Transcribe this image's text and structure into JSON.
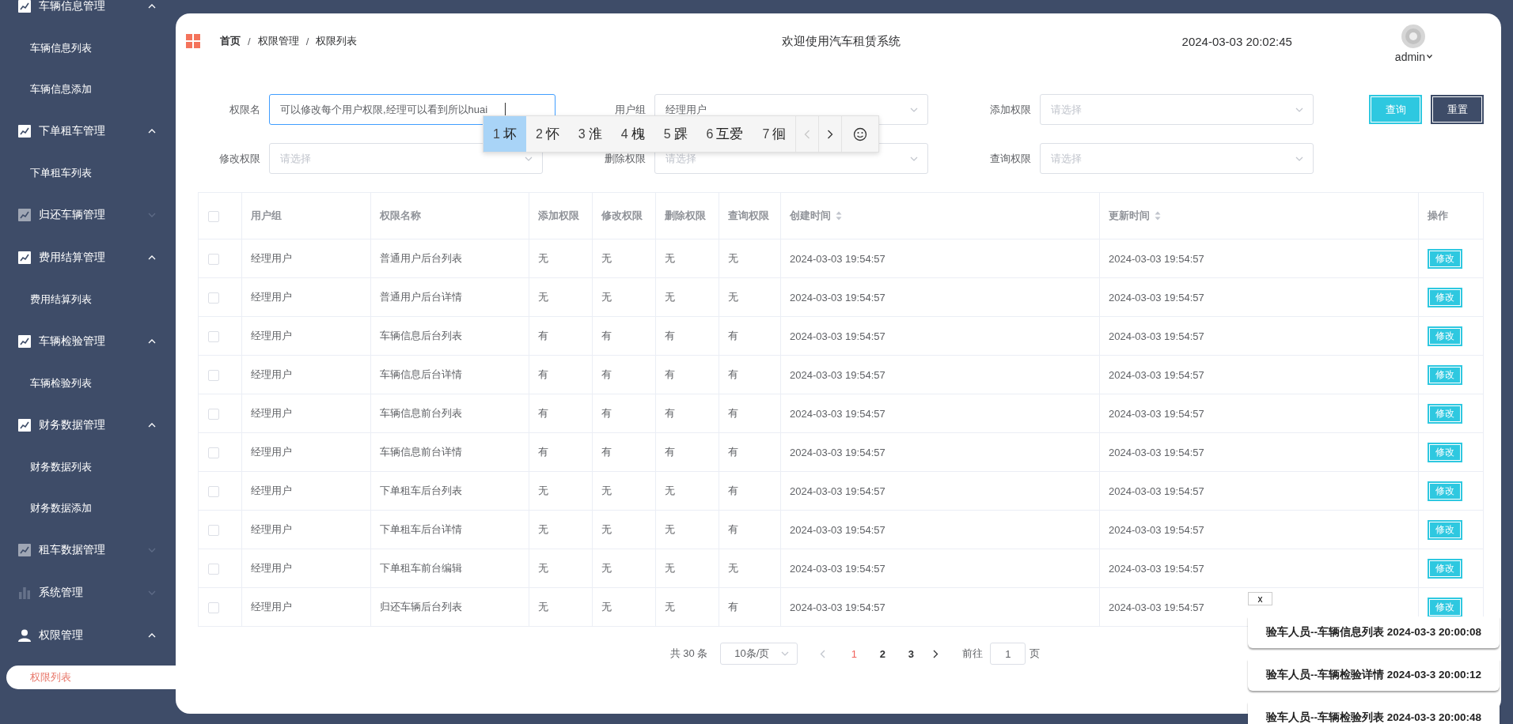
{
  "sidebar": {
    "items": [
      {
        "kind": "chart",
        "label": "车辆信息管理",
        "expanded": true,
        "children": [
          {
            "label": "车辆信息列表",
            "selected": false
          },
          {
            "label": "车辆信息添加",
            "selected": false
          }
        ]
      },
      {
        "kind": "chart",
        "label": "下单租车管理",
        "expanded": true,
        "children": [
          {
            "label": "下单租车列表",
            "selected": false
          }
        ]
      },
      {
        "kind": "chart",
        "label": "归还车辆管理",
        "expanded": false
      },
      {
        "kind": "chart",
        "label": "费用结算管理",
        "expanded": true,
        "children": [
          {
            "label": "费用结算列表",
            "selected": false
          }
        ]
      },
      {
        "kind": "chart",
        "label": "车辆检验管理",
        "expanded": true,
        "children": [
          {
            "label": "车辆检验列表",
            "selected": false
          }
        ]
      },
      {
        "kind": "chart",
        "label": "财务数据管理",
        "expanded": true,
        "children": [
          {
            "label": "财务数据列表",
            "selected": false
          },
          {
            "label": "财务数据添加",
            "selected": false
          }
        ]
      },
      {
        "kind": "chart",
        "label": "租车数据管理",
        "expanded": false
      },
      {
        "kind": "bars",
        "label": "系统管理",
        "expanded": false
      },
      {
        "kind": "user",
        "label": "权限管理",
        "expanded": true,
        "children": [
          {
            "label": "权限列表",
            "selected": true
          }
        ]
      }
    ]
  },
  "header": {
    "breadcrumb": [
      {
        "label": "首页"
      },
      {
        "label": "权限管理"
      },
      {
        "label": "权限列表"
      }
    ],
    "breadcrumb_separator": "/",
    "title": "欢迎使用汽车租赁系统",
    "datetime": "2024-03-03 20:02:45",
    "user": "admin"
  },
  "filters": [
    {
      "kind": "text",
      "label": "权限名",
      "value": "可以修改每个用户权限,经理可以看到所以huai",
      "focused": true
    },
    {
      "kind": "select",
      "label": "用户组",
      "value": "经理用户"
    },
    {
      "kind": "select",
      "label": "添加权限",
      "placeholder": "请选择"
    },
    {
      "kind": "select",
      "label": "修改权限",
      "placeholder": "请选择"
    },
    {
      "kind": "select",
      "label": "删除权限",
      "placeholder": "请选择"
    },
    {
      "kind": "select",
      "label": "查询权限",
      "placeholder": "请选择"
    }
  ],
  "buttons": [
    {
      "kind": "primary",
      "label": "查询"
    },
    {
      "kind": "dark",
      "label": "重置"
    }
  ],
  "ime": {
    "candidates": [
      {
        "number": "1",
        "text": "坏",
        "selected": true
      },
      {
        "number": "2",
        "text": "怀",
        "selected": false
      },
      {
        "number": "3",
        "text": "淮",
        "selected": false
      },
      {
        "number": "4",
        "text": "槐",
        "selected": false
      },
      {
        "number": "5",
        "text": "踝",
        "selected": false
      },
      {
        "number": "6",
        "text": "互爱",
        "selected": false
      },
      {
        "number": "7",
        "text": "徊",
        "selected": false
      }
    ],
    "prev_disabled": true
  },
  "table": {
    "select_all": false,
    "columns": [
      {
        "label": "用户组",
        "sortable": false
      },
      {
        "label": "权限名称",
        "sortable": false
      },
      {
        "label": "添加权限",
        "sortable": false
      },
      {
        "label": "修改权限",
        "sortable": false
      },
      {
        "label": "删除权限",
        "sortable": false
      },
      {
        "label": "查询权限",
        "sortable": false
      },
      {
        "label": "创建时间",
        "sortable": true
      },
      {
        "label": "更新时间",
        "sortable": true
      },
      {
        "label": "操作",
        "sortable": false
      }
    ],
    "rows": [
      {
        "checked": false,
        "cells": [
          "经理用户",
          "普通用户后台列表",
          "无",
          "无",
          "无",
          "无",
          "2024-03-03 19:54:57",
          "2024-03-03 19:54:57"
        ],
        "action": "修改"
      },
      {
        "checked": false,
        "cells": [
          "经理用户",
          "普通用户后台详情",
          "无",
          "无",
          "无",
          "无",
          "2024-03-03 19:54:57",
          "2024-03-03 19:54:57"
        ],
        "action": "修改"
      },
      {
        "checked": false,
        "cells": [
          "经理用户",
          "车辆信息后台列表",
          "有",
          "有",
          "有",
          "有",
          "2024-03-03 19:54:57",
          "2024-03-03 19:54:57"
        ],
        "action": "修改"
      },
      {
        "checked": false,
        "cells": [
          "经理用户",
          "车辆信息后台详情",
          "有",
          "有",
          "有",
          "有",
          "2024-03-03 19:54:57",
          "2024-03-03 19:54:57"
        ],
        "action": "修改"
      },
      {
        "checked": false,
        "cells": [
          "经理用户",
          "车辆信息前台列表",
          "有",
          "有",
          "有",
          "有",
          "2024-03-03 19:54:57",
          "2024-03-03 19:54:57"
        ],
        "action": "修改"
      },
      {
        "checked": false,
        "cells": [
          "经理用户",
          "车辆信息前台详情",
          "有",
          "有",
          "有",
          "有",
          "2024-03-03 19:54:57",
          "2024-03-03 19:54:57"
        ],
        "action": "修改"
      },
      {
        "checked": false,
        "cells": [
          "经理用户",
          "下单租车后台列表",
          "无",
          "无",
          "无",
          "有",
          "2024-03-03 19:54:57",
          "2024-03-03 19:54:57"
        ],
        "action": "修改"
      },
      {
        "checked": false,
        "cells": [
          "经理用户",
          "下单租车后台详情",
          "无",
          "无",
          "无",
          "有",
          "2024-03-03 19:54:57",
          "2024-03-03 19:54:57"
        ],
        "action": "修改"
      },
      {
        "checked": false,
        "cells": [
          "经理用户",
          "下单租车前台编辑",
          "无",
          "无",
          "无",
          "无",
          "2024-03-03 19:54:57",
          "2024-03-03 19:54:57"
        ],
        "action": "修改"
      },
      {
        "checked": false,
        "cells": [
          "经理用户",
          "归还车辆后台列表",
          "无",
          "无",
          "无",
          "有",
          "2024-03-03 19:54:57",
          "2024-03-03 19:54:57"
        ],
        "action": "修改"
      }
    ]
  },
  "pagination": {
    "total": "共 30 条",
    "page_size": "10条/页",
    "pages": [
      {
        "label": "1",
        "selected": true
      },
      {
        "label": "2",
        "selected": false
      },
      {
        "label": "3",
        "selected": false
      }
    ],
    "goto_label": "前往",
    "goto_value": "1",
    "goto_unit": "页"
  },
  "notifications": {
    "close": "x",
    "items": [
      {
        "text": "验车人员--车辆信息列表 2024-03-3 20:00:08"
      },
      {
        "text": "验车人员--车辆检验详情 2024-03-3 20:00:12"
      },
      {
        "text": "验车人员--车辆检验列表 2024-03-3 20:00:48"
      }
    ]
  }
}
